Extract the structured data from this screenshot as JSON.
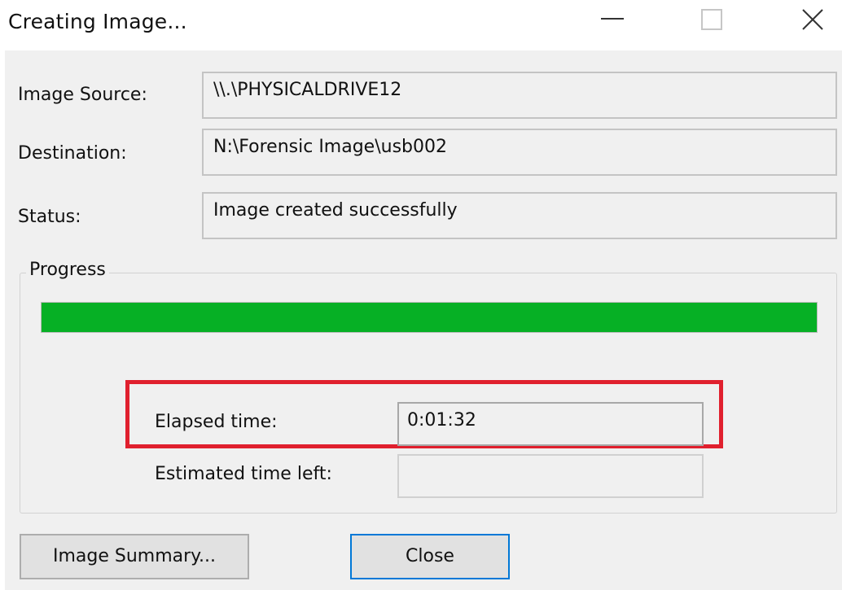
{
  "window": {
    "title": "Creating Image..."
  },
  "fields": {
    "image_source_label": "Image Source:",
    "image_source_value": "\\\\.\\PHYSICALDRIVE12",
    "destination_label": "Destination:",
    "destination_value": "N:\\Forensic Image\\usb002",
    "status_label": "Status:",
    "status_value": "Image created successfully"
  },
  "progress": {
    "group_label": "Progress",
    "fraction": 1.0,
    "elapsed_label": "Elapsed time:",
    "elapsed_value": "0:01:32",
    "estimated_label": "Estimated time left:",
    "estimated_value": ""
  },
  "buttons": {
    "summary_label": "Image Summary...",
    "close_label": "Close"
  },
  "colors": {
    "progress_fill": "#06b025",
    "highlight_border": "#e0202e",
    "default_button_border": "#0078d7"
  },
  "icons": {
    "minimize": "minimize-icon",
    "maximize": "maximize-icon",
    "close": "close-icon"
  }
}
